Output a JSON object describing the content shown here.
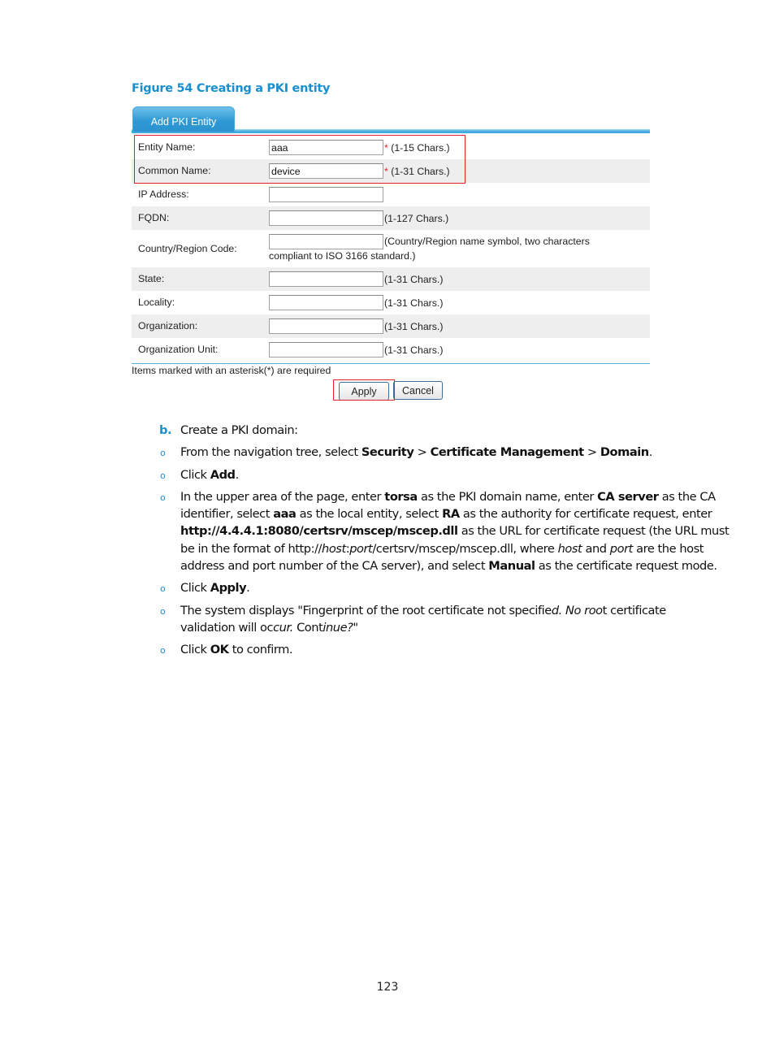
{
  "figure": {
    "caption": "Figure 54 Creating a PKI entity"
  },
  "ui": {
    "tab_label": "Add PKI Entity",
    "fields": [
      {
        "label": "Entity Name:",
        "value": "aaa",
        "required": true,
        "hint": "(1-15 Chars.)"
      },
      {
        "label": "Common Name:",
        "value": "device",
        "required": true,
        "hint": "(1-31 Chars.)"
      },
      {
        "label": "IP Address:",
        "value": "",
        "required": false,
        "hint": ""
      },
      {
        "label": "FQDN:",
        "value": "",
        "required": false,
        "hint": "(1-127 Chars.)"
      },
      {
        "label": "Country/Region Code:",
        "value": "",
        "required": false,
        "hint": "(Country/Region name symbol, two characters",
        "hint_cont": "compliant to ISO 3166 standard.)"
      },
      {
        "label": "State:",
        "value": "",
        "required": false,
        "hint": "(1-31 Chars.)"
      },
      {
        "label": "Locality:",
        "value": "",
        "required": false,
        "hint": "(1-31 Chars.)"
      },
      {
        "label": "Organization:",
        "value": "",
        "required": false,
        "hint": "(1-31 Chars.)"
      },
      {
        "label": "Organization Unit:",
        "value": "",
        "required": false,
        "hint": "(1-31 Chars.)"
      }
    ],
    "asterisk": "*",
    "required_note": "Items marked with an asterisk(*) are required",
    "apply_label": "Apply",
    "cancel_label": "Cancel",
    "accent_color": "#2f9ad6",
    "highlight_color": "#e0202a"
  },
  "steps": {
    "letter": "b.",
    "heading": "Create a PKI domain:",
    "bullet_glyph": "o",
    "items": [
      {
        "parts": [
          {
            "t": "From the navigation tree, select "
          },
          {
            "t": "Security",
            "b": true
          },
          {
            "t": " > "
          },
          {
            "t": "Certificate Management",
            "b": true
          },
          {
            "t": " > "
          },
          {
            "t": "Domain",
            "b": true
          },
          {
            "t": "."
          }
        ]
      },
      {
        "parts": [
          {
            "t": "Click "
          },
          {
            "t": "Add",
            "b": true
          },
          {
            "t": "."
          }
        ]
      },
      {
        "lines": [
          [
            {
              "t": "In the upper area of the page, enter "
            },
            {
              "t": "torsa",
              "b": true
            },
            {
              "t": " as the PKI domain name, enter "
            },
            {
              "t": "CA server",
              "b": true
            },
            {
              "t": " as the CA"
            }
          ],
          [
            {
              "t": "identifier, select "
            },
            {
              "t": "aaa",
              "b": true
            },
            {
              "t": " as the local entity, select "
            },
            {
              "t": "RA",
              "b": true
            },
            {
              "t": " as the authority for certificate request, enter"
            }
          ],
          [
            {
              "t": "http://4.4.4.1:8080/certsrv/mscep/mscep.dll",
              "b": true
            },
            {
              "t": " as the URL for certificate request (the URL must"
            }
          ],
          [
            {
              "t": "be in the format of http://"
            },
            {
              "t": "host",
              "i": true
            },
            {
              "t": ":"
            },
            {
              "t": "port",
              "i": true
            },
            {
              "t": "/certsrv/mscep/mscep.dll, where "
            },
            {
              "t": "host",
              "i": true
            },
            {
              "t": " and "
            },
            {
              "t": "port",
              "i": true
            },
            {
              "t": " are the host"
            }
          ],
          [
            {
              "t": "address and port number of the CA server), and select "
            },
            {
              "t": "Manual",
              "b": true
            },
            {
              "t": " as the certificate request mode."
            }
          ]
        ]
      },
      {
        "parts": [
          {
            "t": "Click "
          },
          {
            "t": "Apply",
            "b": true
          },
          {
            "t": "."
          }
        ]
      },
      {
        "lines": [
          [
            {
              "t": "The system displays \"Fingerprint of the root certificate not specifie"
            },
            {
              "t": "d. No roo",
              "i": true
            },
            {
              "t": "t certificate"
            }
          ],
          [
            {
              "t": "validation will oc"
            },
            {
              "t": "cur.",
              "i": true
            },
            {
              "t": " Cont"
            },
            {
              "t": "inue?",
              "i": true
            },
            {
              "t": "\""
            }
          ]
        ]
      },
      {
        "parts": [
          {
            "t": "Click "
          },
          {
            "t": "OK",
            "b": true
          },
          {
            "t": " to confirm."
          }
        ]
      }
    ]
  },
  "page_number": "123"
}
